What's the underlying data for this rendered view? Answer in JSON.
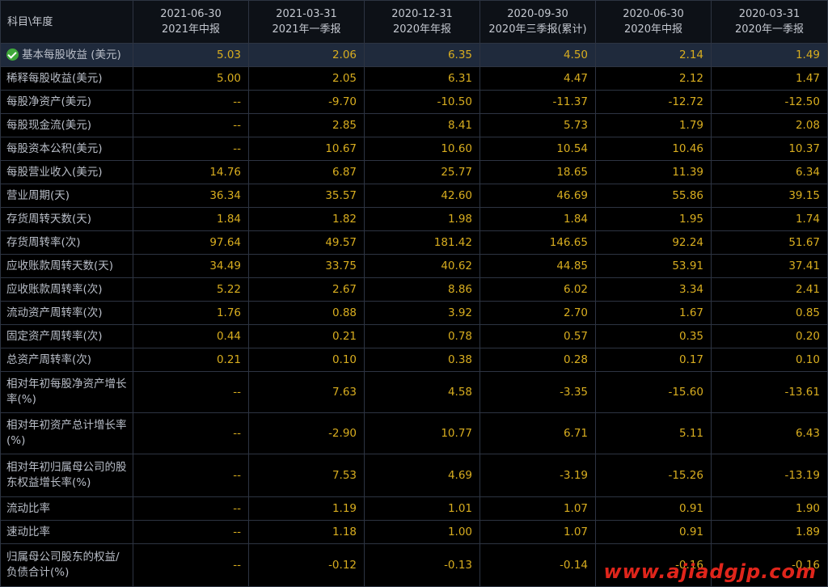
{
  "header": {
    "corner": "科目\\年度",
    "periods": [
      {
        "date": "2021-06-30",
        "label": "2021年中报"
      },
      {
        "date": "2021-03-31",
        "label": "2021年一季报"
      },
      {
        "date": "2020-12-31",
        "label": "2020年年报"
      },
      {
        "date": "2020-09-30",
        "label": "2020年三季报(累计)"
      },
      {
        "date": "2020-06-30",
        "label": "2020年中报"
      },
      {
        "date": "2020-03-31",
        "label": "2020年一季报"
      }
    ]
  },
  "rows": [
    {
      "label": "基本每股收益 (美元)",
      "values": [
        "5.03",
        "2.06",
        "6.35",
        "4.50",
        "2.14",
        "1.49"
      ]
    },
    {
      "label": "稀释每股收益(美元)",
      "values": [
        "5.00",
        "2.05",
        "6.31",
        "4.47",
        "2.12",
        "1.47"
      ]
    },
    {
      "label": "每股净资产(美元)",
      "values": [
        "--",
        "-9.70",
        "-10.50",
        "-11.37",
        "-12.72",
        "-12.50"
      ]
    },
    {
      "label": "每股现金流(美元)",
      "values": [
        "--",
        "2.85",
        "8.41",
        "5.73",
        "1.79",
        "2.08"
      ]
    },
    {
      "label": "每股资本公积(美元)",
      "values": [
        "--",
        "10.67",
        "10.60",
        "10.54",
        "10.46",
        "10.37"
      ]
    },
    {
      "label": "每股营业收入(美元)",
      "values": [
        "14.76",
        "6.87",
        "25.77",
        "18.65",
        "11.39",
        "6.34"
      ]
    },
    {
      "label": "营业周期(天)",
      "values": [
        "36.34",
        "35.57",
        "42.60",
        "46.69",
        "55.86",
        "39.15"
      ]
    },
    {
      "label": "存货周转天数(天)",
      "values": [
        "1.84",
        "1.82",
        "1.98",
        "1.84",
        "1.95",
        "1.74"
      ]
    },
    {
      "label": "存货周转率(次)",
      "values": [
        "97.64",
        "49.57",
        "181.42",
        "146.65",
        "92.24",
        "51.67"
      ]
    },
    {
      "label": "应收账款周转天数(天)",
      "values": [
        "34.49",
        "33.75",
        "40.62",
        "44.85",
        "53.91",
        "37.41"
      ]
    },
    {
      "label": "应收账款周转率(次)",
      "values": [
        "5.22",
        "2.67",
        "8.86",
        "6.02",
        "3.34",
        "2.41"
      ]
    },
    {
      "label": "流动资产周转率(次)",
      "values": [
        "1.76",
        "0.88",
        "3.92",
        "2.70",
        "1.67",
        "0.85"
      ]
    },
    {
      "label": "固定资产周转率(次)",
      "values": [
        "0.44",
        "0.21",
        "0.78",
        "0.57",
        "0.35",
        "0.20"
      ]
    },
    {
      "label": "总资产周转率(次)",
      "values": [
        "0.21",
        "0.10",
        "0.38",
        "0.28",
        "0.17",
        "0.10"
      ]
    },
    {
      "label": "相对年初每股净资产增长率(%)",
      "values": [
        "--",
        "7.63",
        "4.58",
        "-3.35",
        "-15.60",
        "-13.61"
      ]
    },
    {
      "label": "相对年初资产总计增长率(%)",
      "values": [
        "--",
        "-2.90",
        "10.77",
        "6.71",
        "5.11",
        "6.43"
      ]
    },
    {
      "label": "相对年初归属母公司的股东权益增长率(%)",
      "values": [
        "--",
        "7.53",
        "4.69",
        "-3.19",
        "-15.26",
        "-13.19"
      ]
    },
    {
      "label": "流动比率",
      "values": [
        "--",
        "1.19",
        "1.01",
        "1.07",
        "0.91",
        "1.90"
      ]
    },
    {
      "label": "速动比率",
      "values": [
        "--",
        "1.18",
        "1.00",
        "1.07",
        "0.91",
        "1.89"
      ]
    },
    {
      "label": "归属母公司股东的权益/负债合计(%)",
      "values": [
        "--",
        "-0.12",
        "-0.13",
        "-0.14",
        "-0.16",
        "-0.16"
      ]
    }
  ],
  "watermark": "www.ajiadgjp.com"
}
